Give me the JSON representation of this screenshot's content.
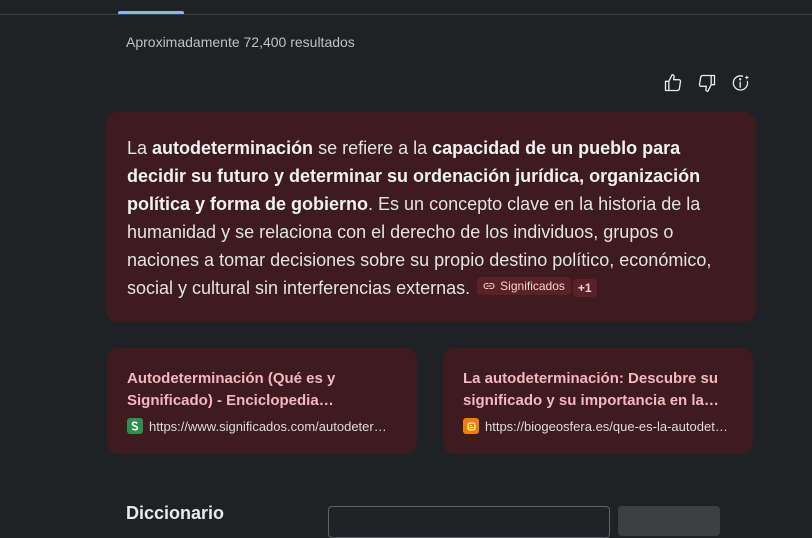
{
  "result_stats": "Aproximadamente 72,400 resultados",
  "feedback": {
    "icons": [
      "thumbs-up-icon",
      "thumbs-down-icon",
      "info-sparkle-icon"
    ]
  },
  "answer": {
    "p1": "La ",
    "b1": "autodeterminación",
    "p2": " se refiere a la ",
    "b2": "capacidad de un pueblo para decidir su futuro y determinar su ordenación jurídica, organización política y forma de gobierno",
    "p3": ". Es un concepto clave en la historia de la humanidad y se relaciona con el derecho de los individuos, grupos o naciones a tomar decisiones sobre su propio destino político, económico, social y cultural sin interferencias externas.",
    "source_chip": "Significados",
    "more_chip": "+1"
  },
  "sources": [
    {
      "title": "Autodeterminación (Qué es y Significado) - Enciclopedia Significados",
      "url": "https://www.significados.com/autodeterminacion/",
      "favicon": "significados-icon"
    },
    {
      "title": "La autodeterminación: Descubre su significado y su importancia en la sociedad",
      "url": "https://biogeosfera.es/que-es-la-autodeterminacion/",
      "favicon": "blogger-icon"
    }
  ],
  "dictionary": {
    "label": "Diccionario"
  },
  "colors": {
    "background": "#202124",
    "card": "#3d1b1e",
    "link": "#f6b6bd",
    "tab_indicator": "#8ab4f8"
  }
}
